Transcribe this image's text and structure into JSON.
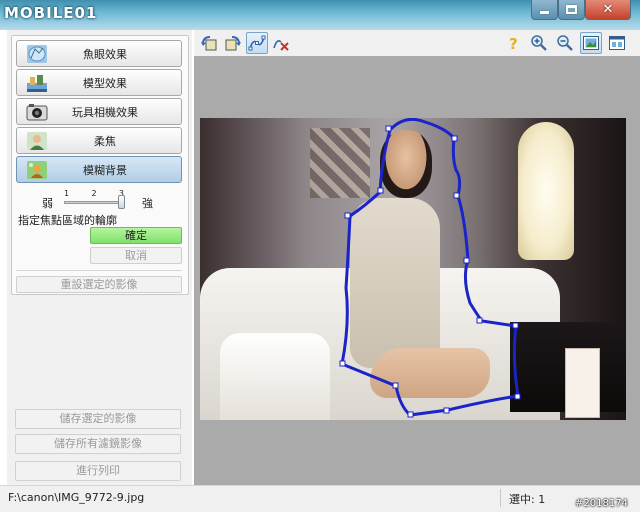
{
  "titlebar": {
    "logo_text": "MOBILE01",
    "minimize_icon": "minimize-icon",
    "maximize_icon": "maximize-icon",
    "close_icon": "close-icon"
  },
  "effects": {
    "items": [
      {
        "label": "魚眼效果",
        "icon": "fisheye-icon"
      },
      {
        "label": "模型效果",
        "icon": "miniature-icon"
      },
      {
        "label": "玩具相機效果",
        "icon": "toy-camera-icon"
      },
      {
        "label": "柔焦",
        "icon": "soft-focus-icon"
      },
      {
        "label": "模糊背景",
        "icon": "blur-background-icon"
      }
    ],
    "active_index": 4
  },
  "slider": {
    "weak_label": "弱",
    "strong_label": "強",
    "tick_1": "1",
    "tick_2": "2",
    "tick_3": "3",
    "value": 3
  },
  "focus": {
    "hint": "指定焦點區域的輪廓",
    "ok_label": "確定",
    "cancel_label": "取消",
    "reset_label": "重設選定的影像"
  },
  "bottom": {
    "save_selected_label": "儲存選定的影像",
    "save_all_label": "儲存所有濾鏡影像",
    "print_label": "進行列印"
  },
  "toolbar": {
    "icons": [
      "rotate-left-icon",
      "rotate-right-icon",
      "freehand-select-icon",
      "clear-selection-icon",
      "help-icon",
      "zoom-in-icon",
      "zoom-out-icon",
      "fit-image-icon",
      "view-mode-icon"
    ]
  },
  "status": {
    "path": "F:\\canon\\IMG_9772-9.jpg",
    "selected": "選中: 1",
    "watermark": "#2018174"
  },
  "colors": {
    "selection_outline": "#1a24c8",
    "ok_button": "#7fe06a",
    "title_bar": "#6cb8d3"
  }
}
